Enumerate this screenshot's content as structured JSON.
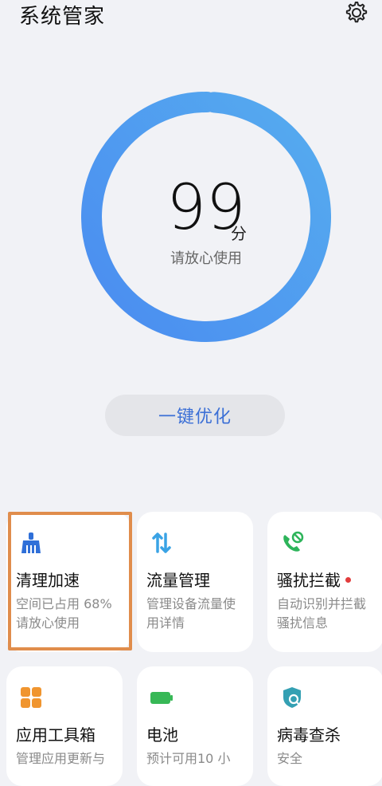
{
  "header": {
    "title": "系统管家",
    "settings_icon": "gear-icon"
  },
  "score": {
    "value": "99",
    "unit": "分",
    "message": "请放心使用",
    "ring_colors": [
      "#4a8cf0",
      "#56acef"
    ]
  },
  "optimize_label": "一键优化",
  "accent": "#3b6fd6",
  "cards": [
    {
      "title": "清理加速",
      "line1": "空间已占用 68%",
      "line2": "请放心使用",
      "icon": "broom-icon",
      "color": "#2f6fd8"
    },
    {
      "title": "流量管理",
      "line1": "管理设备流量使",
      "line2": "用详情",
      "icon": "data-flow-icon",
      "color": "#3aa3e5"
    },
    {
      "title": "骚扰拦截",
      "line1": "自动识别并拦截",
      "line2": "骚扰信息",
      "icon": "phone-block-icon",
      "color": "#2db45a"
    },
    {
      "title": "应用工具箱",
      "line1": "管理应用更新与",
      "line2": "",
      "icon": "apps-grid-icon",
      "color": "#f0952f"
    },
    {
      "title": "电池",
      "line1": "预计可用10 小",
      "line2": "",
      "icon": "battery-icon",
      "color": "#37b856"
    },
    {
      "title": "病毒查杀",
      "line1": "安全",
      "line2": "",
      "icon": "shield-scan-icon",
      "color": "#34a0b3"
    }
  ]
}
